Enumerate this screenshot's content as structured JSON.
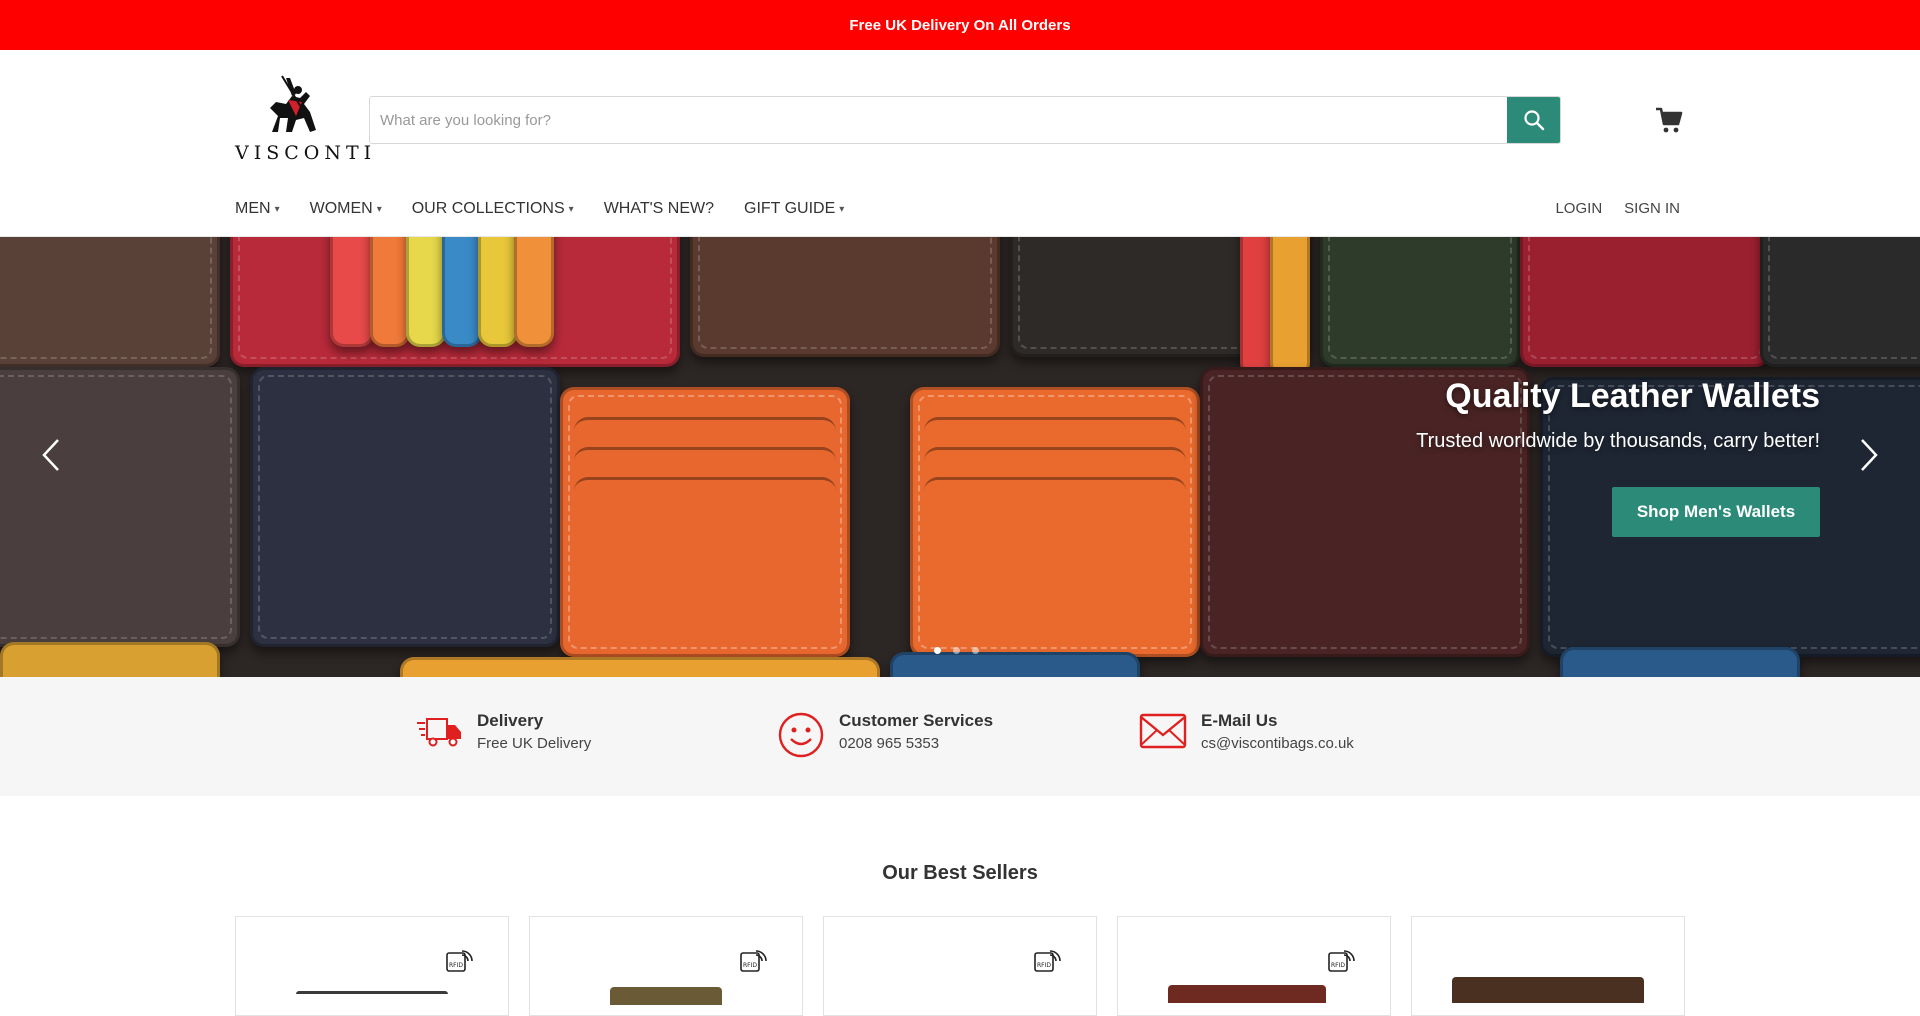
{
  "announcement": "Free UK Delivery On All Orders",
  "brand": {
    "name": "VISCONTI"
  },
  "search": {
    "placeholder": "What are you looking for?"
  },
  "nav": {
    "items": [
      {
        "label": "MEN",
        "dropdown": true
      },
      {
        "label": "WOMEN",
        "dropdown": true
      },
      {
        "label": "OUR COLLECTIONS",
        "dropdown": true
      },
      {
        "label": "WHAT'S NEW?",
        "dropdown": false
      },
      {
        "label": "GIFT GUIDE",
        "dropdown": true
      }
    ],
    "login": "LOGIN",
    "signin": "SIGN IN"
  },
  "hero": {
    "title": "Quality Leather Wallets",
    "subtitle": "Trusted worldwide by thousands, carry better!",
    "cta": "Shop Men's Wallets",
    "prev_icon": "chevron-left-icon",
    "next_icon": "chevron-right-icon",
    "slide_count": 3,
    "active_slide": 1
  },
  "features": [
    {
      "icon": "delivery-truck-icon",
      "title": "Delivery",
      "subtitle": "Free UK Delivery"
    },
    {
      "icon": "smiley-icon",
      "title": "Customer Services",
      "subtitle": "0208 965 5353"
    },
    {
      "icon": "envelope-icon",
      "title": "E-Mail Us",
      "subtitle": "cs@viscontibags.co.uk"
    }
  ],
  "section": {
    "title": "Our Best Sellers"
  },
  "colors": {
    "accent": "#2b8a78",
    "announce_bg": "#ff0000",
    "feature_icon": "#e02020"
  },
  "products": [
    {
      "rfid": true,
      "product_color": "#3a3a3a"
    },
    {
      "rfid": true,
      "product_color": "#6b5a36"
    },
    {
      "rfid": true,
      "product_color": ""
    },
    {
      "rfid": true,
      "product_color": "#6e2a20"
    },
    {
      "rfid": false,
      "product_color": "#4a3020"
    }
  ]
}
